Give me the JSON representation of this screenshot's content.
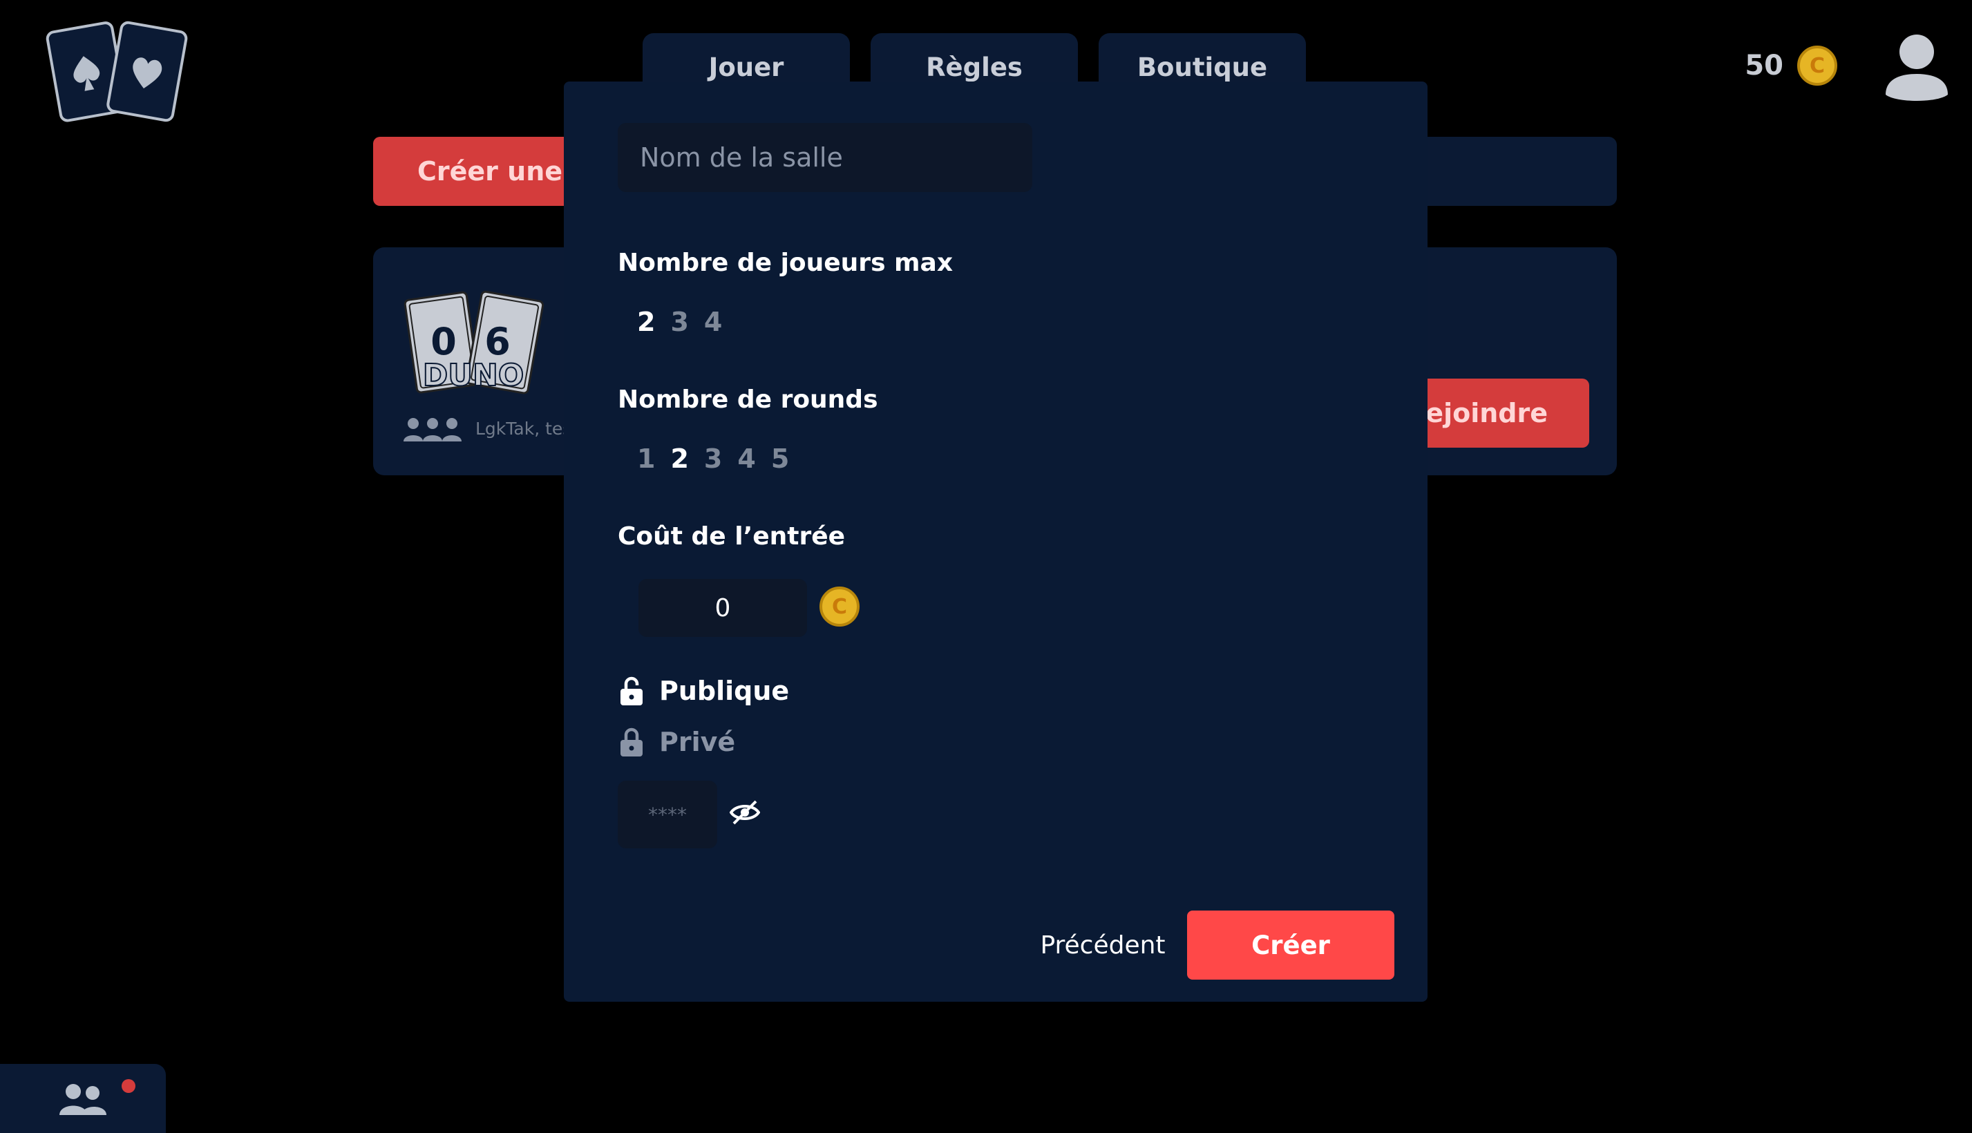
{
  "nav": {
    "tabs": [
      {
        "label": "Jouer"
      },
      {
        "label": "Règles"
      },
      {
        "label": "Boutique"
      }
    ],
    "coins": "50",
    "coin_symbol": "C"
  },
  "lobby": {
    "create_room_label": "Créer une salle",
    "room": {
      "art_text": "DUNO",
      "art_digits": [
        "0",
        "6"
      ],
      "players_text": "LgkTak, test",
      "join_label": "Rejoindre"
    }
  },
  "modal": {
    "room_name_placeholder": "Nom de la salle",
    "max_players_label": "Nombre de joueurs max",
    "max_players_options": [
      "2",
      "3",
      "4"
    ],
    "max_players_selected": "2",
    "rounds_label": "Nombre de rounds",
    "rounds_options": [
      "1",
      "2",
      "3",
      "4",
      "5"
    ],
    "rounds_selected": "2",
    "entry_cost_label": "Coût de l’entrée",
    "entry_cost_value": "0",
    "coin_symbol": "C",
    "public_label": "Publique",
    "private_label": "Privé",
    "password_placeholder": "****",
    "previous_label": "Précédent",
    "create_label": "Créer"
  },
  "colors": {
    "background": "#000000",
    "panel": "#0a1a34",
    "accent_red": "#ff4848",
    "coin_gold": "#e6b525"
  }
}
